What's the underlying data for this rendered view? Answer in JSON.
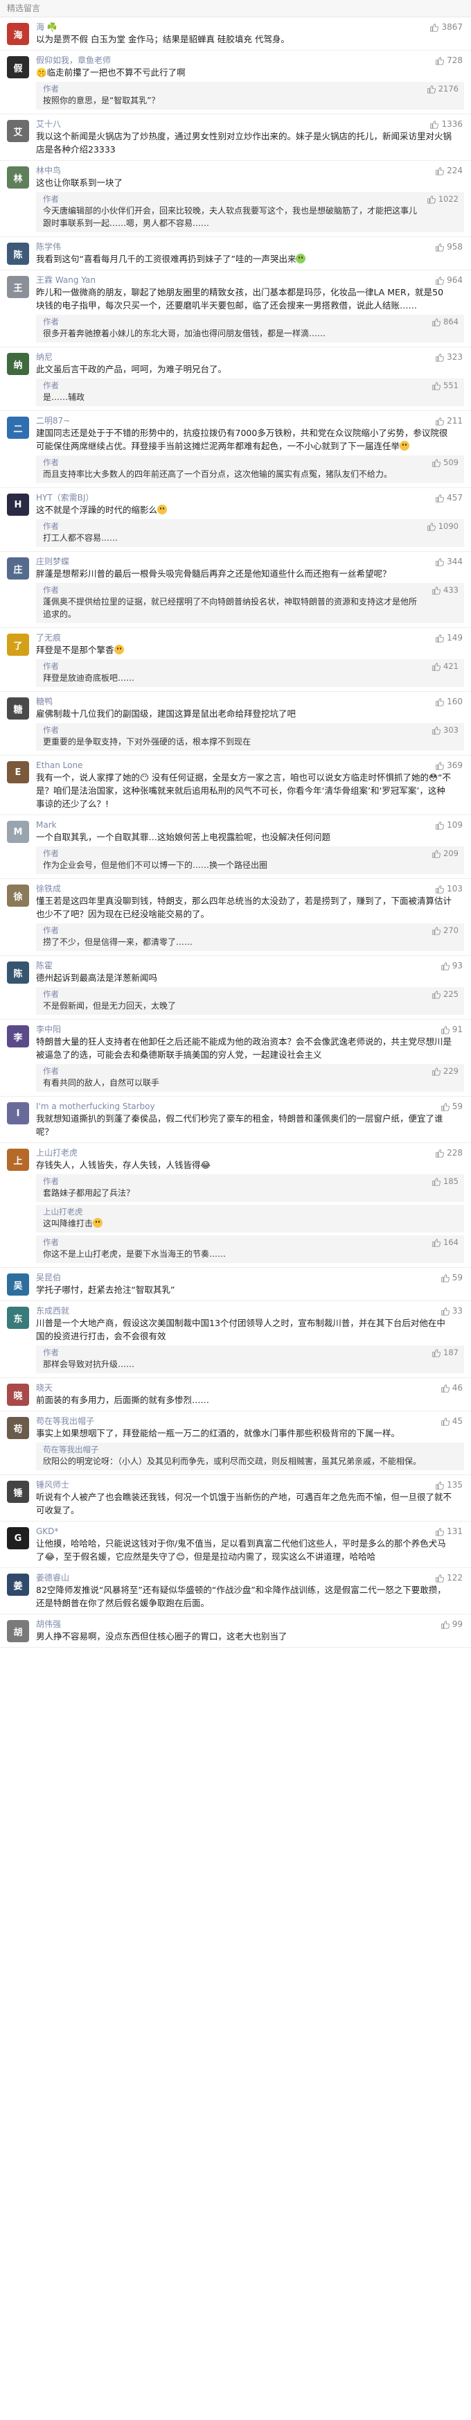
{
  "section_title": "精选留言",
  "comments": [
    {
      "nick": "海 ☘️",
      "color": "#c23a2f",
      "initial": "海",
      "likes": "3867",
      "text": "以为是贾不假 白玉为堂 金作马；结果是貂蝉真 硅胶填充 代驾身。",
      "replies": []
    },
    {
      "nick": "假仰如我，章鱼老师",
      "color": "#2b2b2b",
      "initial": "假",
      "likes": "728",
      "text": "🤫临走前攥了一把也不算不亏此行了啊",
      "replies": [
        {
          "label": "作者",
          "text": "按照你的意思，是“智取其乳”？",
          "likes": "2176"
        }
      ]
    },
    {
      "nick": "艾十八",
      "color": "#6c6c6c",
      "initial": "艾",
      "likes": "1336",
      "text": "我以这个新闻是火锅店为了炒热度，通过男女性别对立炒作出来的。妹子是火锅店的托儿，新闻采访里对火锅店是各种介绍23333",
      "replies": []
    },
    {
      "nick": "林中鸟",
      "color": "#5f7f5a",
      "initial": "林",
      "likes": "224",
      "text": "这也让你联系到一块了",
      "replies": [
        {
          "label": "作者",
          "text": "今天唐编辑部的小伙伴们开会，回来比较晚，夫人软点我要写这个，我也是想破脑筋了，才能把这事儿跟时事联系到一起……嗯，男人都不容易……",
          "likes": "1022"
        }
      ]
    },
    {
      "nick": "陈学伟",
      "color": "#3e5a78",
      "initial": "陈",
      "likes": "958",
      "text": "我看到这句“喜看每月几千的工资很难再扔到妹子了”哇的一声哭出来<span class='emoji green'></span>",
      "replies": []
    },
    {
      "nick": "王霖 Wang Yan",
      "color": "#8a8f98",
      "initial": "王",
      "likes": "964",
      "text": "昨儿和一做微商的朋友，聊起了她朋友圈里的精致女孩，出门基本都是玛莎，化妆品一律LA MER，就是50块钱的电子指甲，每次只买一个，还要磨叽半天要包邮，临了还会搜来一男搭救借，说此人结账……",
      "replies": [
        {
          "label": "作者",
          "text": "很多开着奔驰撩着小妹儿的东北大哥，加油也得问朋友借钱，都是一样滴……",
          "likes": "864"
        }
      ]
    },
    {
      "nick": "纳尼",
      "color": "#3e6a3e",
      "initial": "纳",
      "likes": "323",
      "text": "此文虽后言干政的产品，呵呵，为难子明兄台了。",
      "replies": [
        {
          "label": "作者",
          "text": "是……辅政",
          "likes": "551"
        }
      ]
    },
    {
      "nick": "二明87~",
      "color": "#2f6fb0",
      "initial": "二",
      "likes": "211",
      "text": "建国同志还是处于于不错的形势中的，抗疫拉拨仍有7000多万铁粉，共和党在众议院缩小了劣势，参议院很可能保住两席继续占优。拜登接手当前这摊烂泥两年都难有起色，一不小心就到了下一届连任举<span class='emoji'></span>",
      "replies": [
        {
          "label": "作者",
          "text": "而且支持率比大多数人的四年前还高了一个百分点，这次他输的属实有点冤，猪队友们不给力。",
          "likes": "509"
        }
      ]
    },
    {
      "nick": "HYT（索需BJ）",
      "color": "#2a2a44",
      "initial": "H",
      "likes": "457",
      "text": "这不就是个浮躁的时代的缩影么<span class='emoji'></span>",
      "replies": [
        {
          "label": "作者",
          "text": "打工人都不容易……",
          "likes": "1090"
        }
      ]
    },
    {
      "nick": "庄则梦蝶",
      "color": "#556b8e",
      "initial": "庄",
      "likes": "344",
      "text": "胖蓬是想帮彩川普的最后一根骨头吸完骨髓后再弃之还是他知道些什么而还抱有一丝希望呢？",
      "replies": [
        {
          "label": "作者",
          "text": "蓬佩奥不提供给拉里的证据，就已经摆明了不向特朗普纳投名状，神取特朗普的资源和支持这才是他所追求的。",
          "likes": "433"
        }
      ]
    },
    {
      "nick": "了无痕",
      "color": "#d4a017",
      "initial": "了",
      "likes": "149",
      "text": "拜登是不是那个擎香<span class='emoji'></span>",
      "replies": [
        {
          "label": "作者",
          "text": "拜登是放迪奇底板吧……",
          "likes": "421"
        }
      ]
    },
    {
      "nick": "糖鸭",
      "color": "#4a4a4a",
      "initial": "糖",
      "likes": "160",
      "text": "雇佛制裁十几位我们的副国级，建国这算是鼠出老命给拜登挖坑了吧",
      "replies": [
        {
          "label": "作者",
          "text": "更重要的是争取支持，下对外强硬的话，根本撑不到现在",
          "likes": "303"
        }
      ]
    },
    {
      "nick": "Ethan Lone",
      "color": "#7a5a3a",
      "initial": "E",
      "likes": "369",
      "text": "我有一个，说人家撑了她的😶 没有任何证据，全是女方一家之言，咱也可以说女方临走时怀惧抓了她的😳“不是？咱们是法治国家，这种张嘴就来就后追用私刑的风气不可长，你看今年‘清华骨组案’和‘罗冠军案’，这种事谅的还少了么？!",
      "replies": []
    },
    {
      "nick": "Mark",
      "color": "#9aa4ae",
      "initial": "M",
      "likes": "109",
      "text": "一个自取其乳，一个自取其罪…这始娘何苦上电视露脸呢，也没解决任何问题",
      "replies": [
        {
          "label": "作者",
          "text": "作为企业会号，但是他们不可以博一下的……换一个路径出圈",
          "likes": "209"
        }
      ]
    },
    {
      "nick": "徐铁成",
      "color": "#8a7a5a",
      "initial": "徐",
      "likes": "103",
      "text": "懂王若是这四年里真没聊到钱，特朗支，那么四年总统当的太没劲了，若是捞到了，赚到了，下面被清算估计也少不了吧？因为现在已经没啥能交易的了。",
      "replies": [
        {
          "label": "作者",
          "text": "捞了不少，但是信得一来，都清零了……",
          "likes": "270"
        }
      ]
    },
    {
      "nick": "陈霍",
      "color": "#36556e",
      "initial": "陈",
      "likes": "93",
      "text": "德州起诉到最高法是洋葱新闻吗",
      "replies": [
        {
          "label": "作者",
          "text": "不是假新闻，但是无力回天，太晚了",
          "likes": "225"
        }
      ]
    },
    {
      "nick": "李中阳",
      "color": "#5b4a8a",
      "initial": "李",
      "likes": "91",
      "text": "特朗普大量的狂人支持者在他卸任之后还能不能成为他的政治资本？会不会像武逸老师说的，共主党尽想川是被逼急了的选，可能会去和桑德斯联手搞美国的穷人党，一起建设社会主义",
      "replies": [
        {
          "label": "作者",
          "text": "有看共同的敌人，自然可以联手",
          "likes": "229"
        }
      ]
    },
    {
      "nick": "I'm a motherfucking Starboy",
      "color": "#6a6a9a",
      "initial": "I",
      "likes": "59",
      "text": "我就想知道撕扒的到蓬了秦侯品，假二代们秒完了豪车的租金，特朗普和蓬佩奥们的一层窗户纸，便宜了谁呢？",
      "replies": []
    },
    {
      "nick": "上山打老虎",
      "color": "#b56a2a",
      "initial": "上",
      "likes": "228",
      "text": "存钱失人，人钱皆失，存人失钱，人钱皆得😂",
      "replies": [
        {
          "label": "作者",
          "text": "套路妹子都用起了兵法？",
          "likes": "185"
        },
        {
          "label": "上山打老虎",
          "text": "这叫降维打击<span class='emoji'></span>",
          "likes": ""
        },
        {
          "label": "作者",
          "text": "你这不是上山打老虎，是要下水当海王的节奏……",
          "likes": "164"
        }
      ]
    },
    {
      "nick": "吴昆伯",
      "color": "#2e6e9e",
      "initial": "吴",
      "likes": "59",
      "text": "学托子哪忖，赶紧去抢注“智取其乳”",
      "replies": []
    },
    {
      "nick": "东成西就",
      "color": "#3a7a7a",
      "initial": "东",
      "likes": "33",
      "text": "川普是一个大地产商，假设这次美国制裁中国13个付团领导人之时，宣布制裁川普，并在其下台后对他在中国的投资进行打击，会不会很有效",
      "replies": [
        {
          "label": "作者",
          "text": "那样会导致对抗升级……",
          "likes": "187"
        }
      ]
    },
    {
      "nick": "晓天",
      "color": "#a84a4a",
      "initial": "晓",
      "likes": "46",
      "text": "前面装的有多用力，后面撕的就有多惨烈……",
      "replies": []
    },
    {
      "nick": "苟在等我出帽子",
      "color": "#6b5b4b",
      "initial": "苟",
      "likes": "45",
      "text": "事实上如果想咽下了，拜登能给一瓶一万二的红酒的，就像水门事件那些积极背帘的下属一样。",
      "replies": [
        {
          "label": "苟在等我出帽子",
          "text": "欣阳公的明宠论呀：（小人）及其见利而争先，或利尽而交疏，则反相贼害，虽其兄弟亲戚，不能相保。",
          "likes": ""
        }
      ]
    },
    {
      "nick": "锤风师士",
      "color": "#444444",
      "initial": "锤",
      "likes": "135",
      "text": "听说有个人被产了也会瞧装还我钱，何况一个饥饿于当新伤的产地，可遇百年之危先而不愉，但一旦很了就不可收复了。",
      "replies": []
    },
    {
      "nick": "GKD*",
      "color": "#1f1f1f",
      "initial": "G",
      "likes": "131",
      "text": "让他摸，哈哈哈，只能说这钱对于你/鬼不值当，足以看到真富二代他们这些人，平时是多么的那个养色犬马了😂，至于假名媛，它应然是失守了😊，但是是拉动内需了，现实这么不讲道理，哈哈哈",
      "replies": []
    },
    {
      "nick": "姜德睿山",
      "color": "#2f4a6a",
      "initial": "姜",
      "likes": "122",
      "text": "82空降师发推说“风暴将至”还有疑似华盛顿的“作战沙盘”和伞降作战训练，这是假富二代一怒之下要敢攒，还是特朗普在你了然后假名媛争取跑在后面。",
      "replies": []
    },
    {
      "nick": "胡伟强",
      "color": "#7a7a7a",
      "initial": "胡",
      "likes": "99",
      "text": "男人挣不容易啊，没点东西但住核心圈子的胃口，这老大也别当了",
      "replies": []
    }
  ]
}
